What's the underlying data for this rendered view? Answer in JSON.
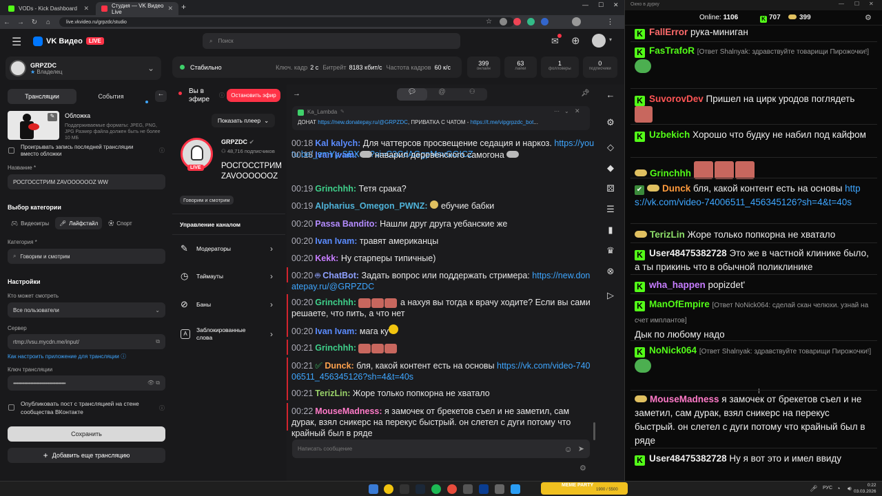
{
  "browser": {
    "tabs": [
      {
        "title": "VODs - Kick Dashboard",
        "icon_color": "#53fc18"
      },
      {
        "title": "Студия — VK Видео Live",
        "icon_color": "#ff3347"
      }
    ],
    "url": "live.vkvideo.ru/grpzdc/studio"
  },
  "header": {
    "brand": "VK Видео",
    "live_badge": "LIVE",
    "search_placeholder": "Поиск"
  },
  "left": {
    "channel_name": "GRPZDC",
    "channel_role": "Владелец",
    "tab_streams": "Трансляции",
    "tab_events": "События",
    "cover_title": "Обложка",
    "cover_hint": "Поддерживаемые форматы: JPEG, PNG, JPG Размер файла должен быть не более 10 МБ",
    "replay_label": "Проигрывать запись последней трансляции вместо обложки",
    "name_label": "Название *",
    "name_value": "РОСГОССТРИМ ZAVOOOOOOZ WW",
    "category_section": "Выбор категории",
    "cat_games": "Видеоигры",
    "cat_lifestyle": "Лайфстайл",
    "cat_sport": "Спорт",
    "category_label": "Категория *",
    "category_value": "Говорим и смотрим",
    "settings_title": "Настройки",
    "who_label": "Кто может смотреть",
    "who_value": "Все пользователи",
    "server_label": "Сервер",
    "server_value": "rtmp://vsu.mycdn.me/input/",
    "howto_link": "Как настроить приложение для трансляции",
    "key_label": "Ключ трансляции",
    "key_value": "••••••••••••••••••••••••••••••••••••••••••",
    "publish_label": "Опубликовать пост с трансляцией на стене сообщества ВКонтакте",
    "save_button": "Сохранить",
    "add_button": "Добавить еще трансляцию"
  },
  "status": {
    "state": "Стабильно",
    "keyframe_label": "Ключ. кадр",
    "keyframe_value": "2 с",
    "bitrate_label": "Битрейт",
    "bitrate_value": "8183 кбит/с",
    "fps_label": "Частота кадров",
    "fps_value": "60 к/с",
    "stats": [
      {
        "value": "399",
        "label": "онлайн"
      },
      {
        "value": "63",
        "label": "лайки"
      },
      {
        "value": "1",
        "label": "фолловеры"
      },
      {
        "value": "0",
        "label": "подписчики"
      }
    ]
  },
  "middle": {
    "on_air": "Вы в эфире",
    "stop_button": "Остановить эфир",
    "show_player": "Показать плеер",
    "channel": "GRPZDC",
    "subs": "48,716 подписчиков",
    "title": "РОСГОССТРИМ ZAVOOOOOOZ WW",
    "live_badge": "LIVE",
    "category_chip": "Говорим и смотрим",
    "manage_title": "Управление каналом",
    "menu": [
      "Модераторы",
      "Таймауты",
      "Баны",
      "Заблокированные слова"
    ]
  },
  "chat": {
    "pinned_user": "Ka_Lambda",
    "pinned_prefix": "ДОНАТ",
    "pinned_link1": "https://new.donatepay.ru/@GRPZDC",
    "pinned_mid": ", ПРИВАТКА С ЧАТОМ -",
    "pinned_link2": "https://t.me/vipgrpzdc_bot",
    "pinned_more": "...",
    "input_placeholder": "Написать сообщение",
    "messages": [
      {
        "t": "00:18",
        "u": "Kal kalych:",
        "c": "#5b8cff",
        "text": "Для чаттерсов просвещение седация и наркоз.",
        "link": "https://youtu.be/_zmYy-SBXoE?si=C3CdAGgpMsvGGICZ"
      },
      {
        "t": "00:18",
        "u": "Ivan Ivam:",
        "c": "#5b8cff",
        "text": "наварил деревенского самогона",
        "link": ""
      },
      {
        "t": "00:19",
        "u": "Grinchhh:",
        "c": "#3fd18b",
        "text": "Тетя срака?",
        "link": ""
      },
      {
        "t": "00:19",
        "u": "Alpharius_Omegon_PWNZ:",
        "c": "#4fb3d9",
        "text": "ебучие бабки",
        "link": ""
      },
      {
        "t": "00:20",
        "u": "Passa Bandito:",
        "c": "#b48cff",
        "text": "Нашли друг друга уебанские же",
        "link": ""
      },
      {
        "t": "00:20",
        "u": "Ivan Ivam:",
        "c": "#5b8cff",
        "text": "травят американцы",
        "link": ""
      },
      {
        "t": "00:20",
        "u": "Kekk:",
        "c": "#c77dff",
        "text": "Ну старперы типичные)",
        "link": ""
      },
      {
        "t": "00:20",
        "u": "ChatBot:",
        "c": "#8ea0ff",
        "text": "Задать вопрос или поддержать стримера:",
        "link": "https://new.donatepay.ru/@GRPZDC"
      },
      {
        "t": "00:20",
        "u": "Grinchhh:",
        "c": "#3fd18b",
        "text": "а нахуя вы тогда к врачу ходите? Если вы сами решаете, что пить, а что нет",
        "link": ""
      },
      {
        "t": "00:20",
        "u": "Ivan Ivam:",
        "c": "#5b8cff",
        "text": "мага ку",
        "link": ""
      },
      {
        "t": "00:21",
        "u": "Grinchhh:",
        "c": "#3fd18b",
        "text": "",
        "link": ""
      },
      {
        "t": "00:21",
        "u": "Dunck:",
        "c": "#ffa24d",
        "text": "бля, какой контент есть на основы",
        "link": "https://vk.com/video-74006511_456345126?sh=4&t=40s"
      },
      {
        "t": "00:21",
        "u": "TerizLin:",
        "c": "#9ad36a",
        "text": "Жоре только попкорна не хватало",
        "link": ""
      },
      {
        "t": "00:22",
        "u": "MouseMadness:",
        "c": "#ff7ac8",
        "text": "я замочек от брекетов съел и не заметил, сам дурак, взял сникерс на перекус быстрый. он слетел с дуги потому что крайный был в ряде",
        "link": ""
      }
    ]
  },
  "kick": {
    "window_title": "Окно в дурку",
    "online_label": "Online:",
    "online_value": "1106",
    "count1": "707",
    "count2": "399",
    "messages": [
      {
        "u": "FallError",
        "c": "#ff6b6b",
        "reply": "",
        "text": "рука-миниган",
        "link": ""
      },
      {
        "u": "FasTrafoR",
        "c": "#53fc18",
        "reply": "[Ответ Shalnyak: здравствуйте товарищи Пирожочки!]",
        "text": "",
        "link": ""
      },
      {
        "u": "SuvorovDev",
        "c": "#ff5555",
        "reply": "",
        "text": "Пришел на цирк уродов поглядеть",
        "link": ""
      },
      {
        "u": "Uzbekich",
        "c": "#53fc18",
        "reply": "",
        "text": "Хорошо что будку не набил под кайфом",
        "link": ""
      },
      {
        "u": "Grinchhh",
        "c": "#53fc18",
        "reply": "",
        "text": "",
        "link": ""
      },
      {
        "u": "Dunck",
        "c": "#ff9a3c",
        "reply": "",
        "text": "бля, какой контент есть на основы",
        "link": "https://vk.com/video-74006511_456345126?sh=4&t=40s"
      },
      {
        "u": "TerizLin",
        "c": "#8ee06a",
        "reply": "",
        "text": "Жоре только попкорна не хватало",
        "link": ""
      },
      {
        "u": "User48475382728",
        "c": "#eeeeee",
        "reply": "",
        "text": "Это же в частной клинике было, а ты прикинь что в обычной поликлинике",
        "link": ""
      },
      {
        "u": "wha_happen",
        "c": "#c77dff",
        "reply": "",
        "text": "popizdet'",
        "link": ""
      },
      {
        "u": "ManOfEmpire",
        "c": "#53fc18",
        "reply": "[Ответ NoNick064: сделай скан челюхи. узнай на счет имплантов]",
        "text": "Дык по любому надо",
        "link": ""
      },
      {
        "u": "NoNick064",
        "c": "#53fc18",
        "reply": "[Ответ Shalnyak: здравствуйте товарищи Пирожочки!]",
        "text": "",
        "link": ""
      },
      {
        "u": "MouseMadness",
        "c": "#ff7ac8",
        "reply": "",
        "text": "я замочек от брекетов съел и не заметил, сам дурак, взял сникерс на перекус быстрый. он слетел с дуги потому что крайный был в ряде",
        "link": ""
      },
      {
        "u": "User48475382728",
        "c": "#eeeeee",
        "reply": "",
        "text": "Ну я вот это и имел ввиду",
        "link": ""
      }
    ]
  },
  "taskbar": {
    "lang": "РУС",
    "time": "0:22",
    "date": "03.03.2026",
    "meme_party": "MEME PARTY",
    "meme_counter": "1900 / 5500"
  }
}
